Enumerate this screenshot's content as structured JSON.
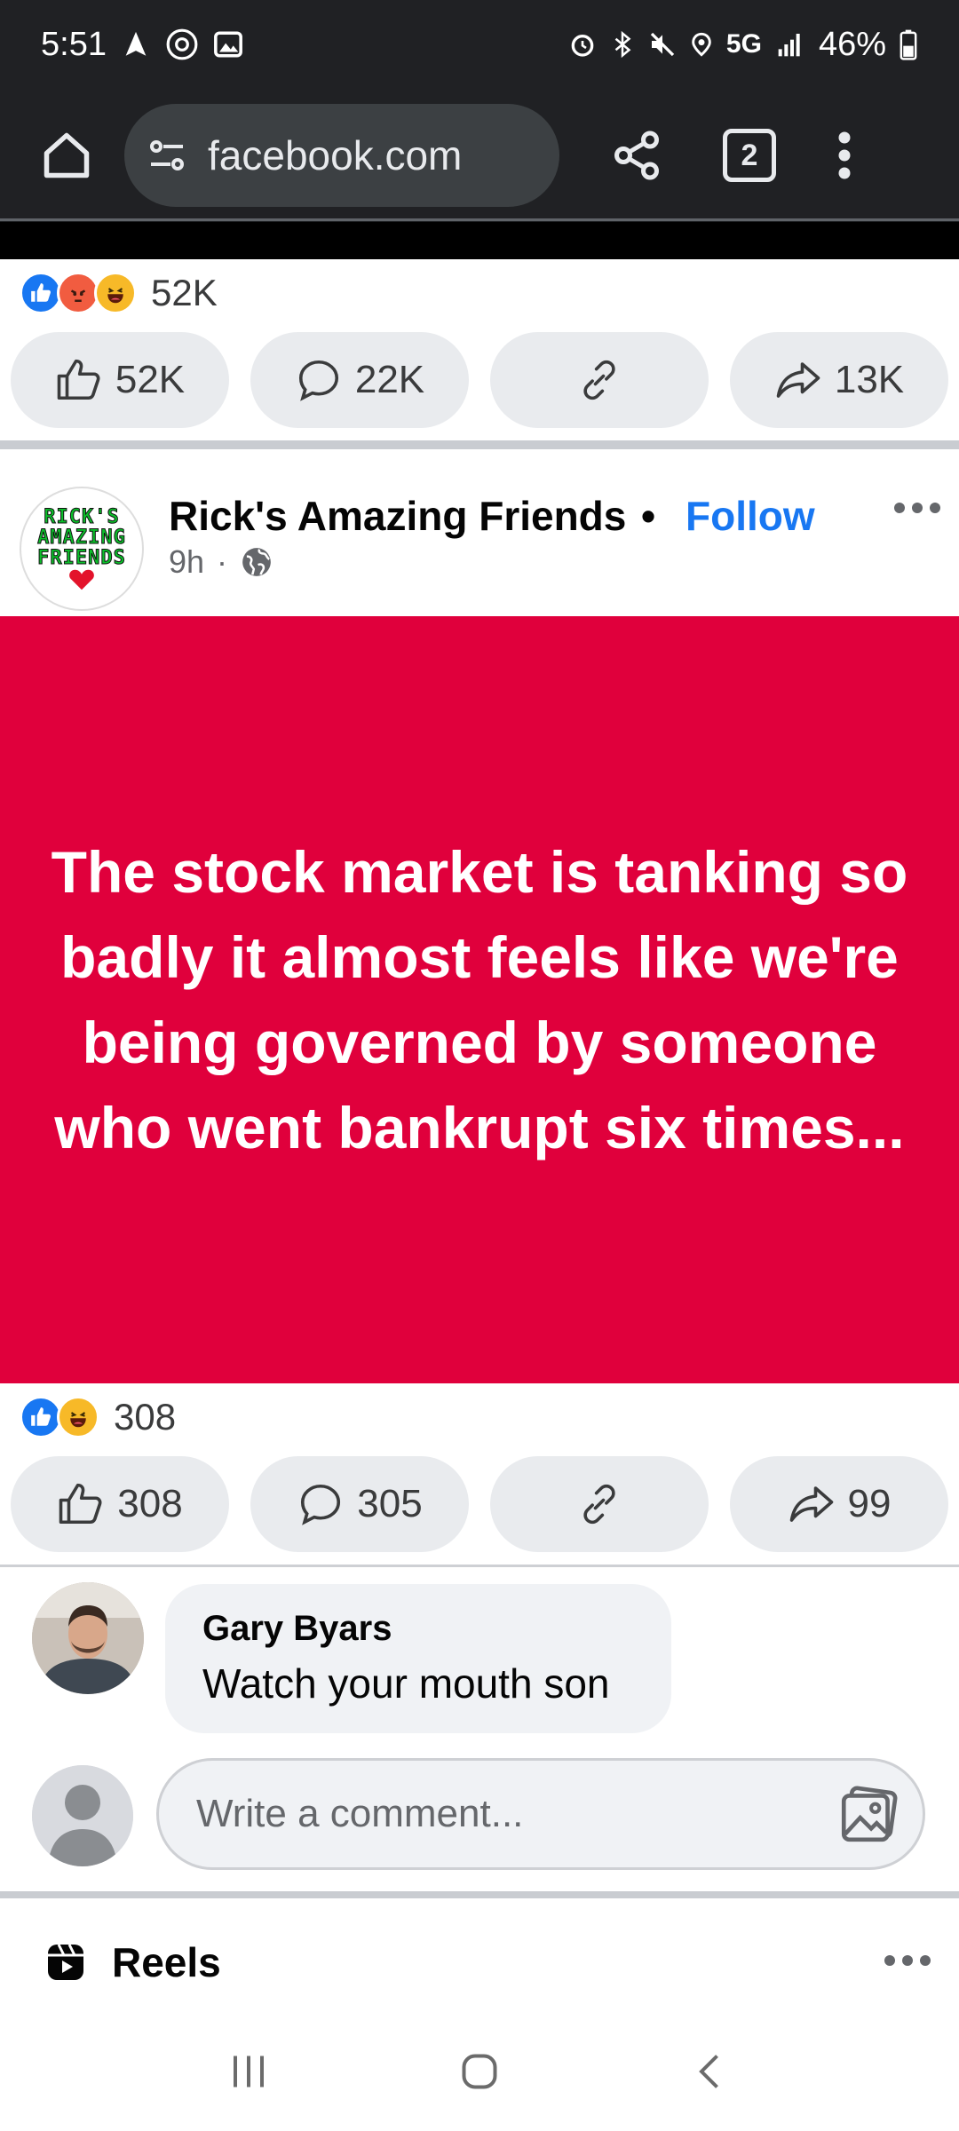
{
  "status_bar": {
    "time": "5:51",
    "network": "5G",
    "battery": "46%"
  },
  "browser": {
    "url": "facebook.com",
    "tab_count": "2"
  },
  "prev_post": {
    "reaction_total": "52K",
    "like_count": "52K",
    "comment_count": "22K",
    "share_count": "13K"
  },
  "post": {
    "page_name": "Rick's Amazing Friends",
    "separator": "•",
    "follow_label": "Follow",
    "time": "9h",
    "time_sep": "·",
    "avatar_text": [
      "RICK'S",
      "AMAZING",
      "FRIENDS"
    ],
    "image_text": "The stock market is tanking so badly it almost feels like we're being governed by someone who went bankrupt six times...",
    "image_bg": "#e0003c",
    "reaction_total": "308",
    "like_count": "308",
    "comment_count": "305",
    "share_count": "99"
  },
  "comment": {
    "author": "Gary Byars",
    "text": "Watch your mouth son"
  },
  "composer": {
    "placeholder": "Write a comment..."
  },
  "reels": {
    "title": "Reels"
  },
  "colors": {
    "accent": "#1877f2",
    "browser_chrome": "#202124",
    "button_bg": "#e9ebee"
  }
}
